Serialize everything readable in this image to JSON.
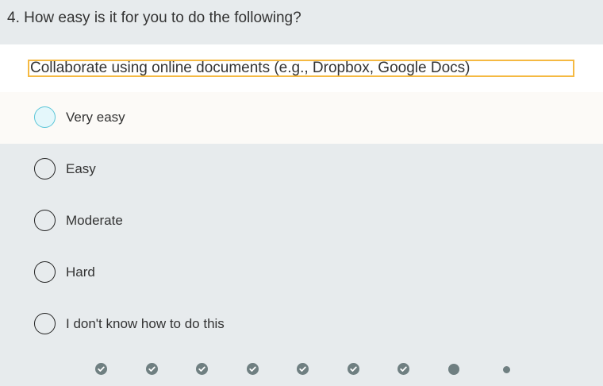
{
  "question": {
    "title": "4. How easy is it for you to do the following?"
  },
  "subquestion": {
    "label": "Collaborate using online documents (e.g., Dropbox, Google Docs)"
  },
  "options": [
    {
      "label": "Very easy"
    },
    {
      "label": "Easy"
    },
    {
      "label": "Moderate"
    },
    {
      "label": "Hard"
    },
    {
      "label": "I don't know how to do this"
    }
  ],
  "progress": {
    "completed": 7,
    "current": 8,
    "total": 9
  },
  "colors": {
    "background": "#e7ebed",
    "highlight_row": "#fcfaf7",
    "focus_outline": "#f5b942",
    "radio_focus": "#5bc6d8",
    "progress_dot": "#6f7f81"
  },
  "icons": {
    "completed_step": "check-circle-icon",
    "current_step": "filled-dot-icon",
    "pending_step": "small-dot-icon"
  }
}
